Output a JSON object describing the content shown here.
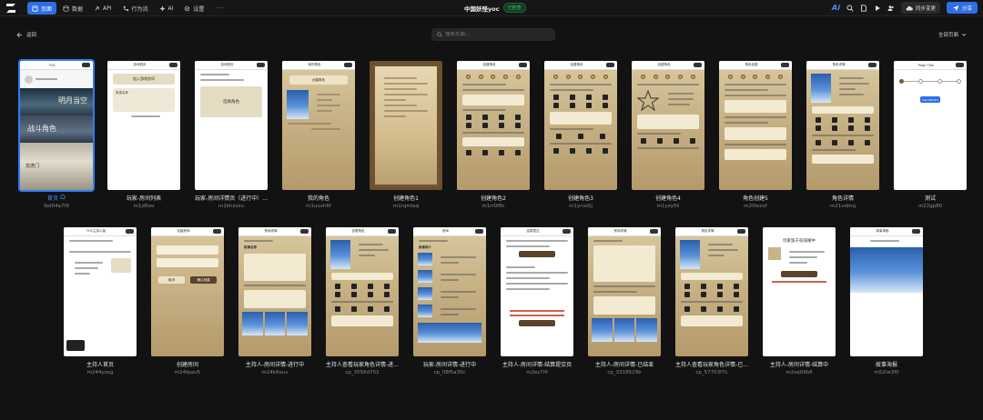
{
  "nav": {
    "items": [
      {
        "label": "页面",
        "icon": "page-icon",
        "active": true
      },
      {
        "label": "数据",
        "icon": "database-icon",
        "active": false
      },
      {
        "label": "API",
        "icon": "api-icon",
        "active": false
      },
      {
        "label": "行为流",
        "icon": "flow-icon",
        "active": false
      },
      {
        "label": "AI",
        "icon": "ai-icon",
        "active": false
      },
      {
        "label": "设置",
        "icon": "gear-icon",
        "active": false
      }
    ],
    "more": "···"
  },
  "project": {
    "title": "中国妖怪yoc",
    "status": "已检查"
  },
  "toolbar": {
    "ai_logo": "Ai",
    "sync_label": "同步变更",
    "share_label": "分享"
  },
  "back_label": "返回",
  "search": {
    "placeholder": "搜索页面..."
  },
  "filter_label": "全部页面",
  "colors": {
    "accent": "#2f6fe6",
    "background": "#121212",
    "parchment": "#d3bd8e"
  },
  "pages": [
    {
      "name": "首页",
      "id": "lbd04a7f9",
      "selected": true,
      "home": true,
      "thumb_title": "YOC",
      "thumb_text": [
        "明月当空",
        "战斗角色",
        "龙虎门"
      ]
    },
    {
      "name": "玩家-房间列表",
      "id": "m1z8izo",
      "thumb_title": "游戏首页",
      "thumb_text": [
        "加入游戏房间",
        "故事名称"
      ]
    },
    {
      "name": "玩家-房间详情页（进行中）...",
      "id": "m1khzvzu",
      "thumb_title": "游戏首页",
      "thumb_text": [
        "选择角色"
      ]
    },
    {
      "name": "我的角色",
      "id": "m1uovh6f",
      "thumb_title": "我的角色",
      "thumb_text": [
        "创建角色"
      ]
    },
    {
      "name": "创建角色1",
      "id": "m1rqmlaq",
      "thumb_title": "",
      "thumb_text": []
    },
    {
      "name": "创建角色2",
      "id": "m1rr0f8c",
      "thumb_title": "创建角色",
      "thumb_text": []
    },
    {
      "name": "创建角色3",
      "id": "m1yrus5j",
      "thumb_title": "创建角色",
      "thumb_text": []
    },
    {
      "name": "创建角色4",
      "id": "m1yzy0il",
      "thumb_title": "创建角色",
      "thumb_text": []
    },
    {
      "name": "角色创建5",
      "id": "m20lecvf",
      "thumb_title": "角色创建",
      "thumb_text": []
    },
    {
      "name": "角色详情",
      "id": "m21vdmq",
      "thumb_title": "角色详情",
      "thumb_text": []
    },
    {
      "name": "测试",
      "id": "m22gp80",
      "thumb_title": "Page Title",
      "thumb_text": [
        "Get Started"
      ]
    },
    {
      "name": "主持人首页",
      "id": "m244yosg",
      "thumb_title": "YOC主持人版",
      "thumb_text": []
    },
    {
      "name": "创建房间",
      "id": "m24fpau5",
      "thumb_title": "创建房间",
      "thumb_text": [
        "取消",
        "确认创建"
      ]
    },
    {
      "name": "主持人-房间详情-进行中",
      "id": "m24k6euv",
      "thumb_title": "房间详情",
      "thumb_text": [
        "故事名称"
      ]
    },
    {
      "name": "主持人查看玩家角色详情-进...",
      "id": "cp_3556d751",
      "thumb_title": "查看角色",
      "thumb_text": []
    },
    {
      "name": "玩家-房间详情-进行中",
      "id": "cp_08f5a30c",
      "thumb_title": "房间",
      "thumb_text": [
        "故事简介"
      ]
    },
    {
      "name": "主持人-房间详情-结算提交页",
      "id": "m2es7ifi",
      "thumb_title": "结算提交",
      "thumb_text": []
    },
    {
      "name": "主持人-房间详情-已结束",
      "id": "cp_3318529b",
      "thumb_title": "房间详情",
      "thumb_text": []
    },
    {
      "name": "主持人查看玩家角色详情-已...",
      "id": "cp_57703f7c",
      "thumb_title": "角色详情",
      "thumb_text": []
    },
    {
      "name": "主持人-房间详情-结算中",
      "id": "m2sq09b8",
      "thumb_title": "",
      "thumb_text": [
        "玩家留于前排撤中"
      ]
    },
    {
      "name": "故事海报",
      "id": "m52lw3f0",
      "thumb_title": "故事海报",
      "thumb_text": []
    }
  ]
}
